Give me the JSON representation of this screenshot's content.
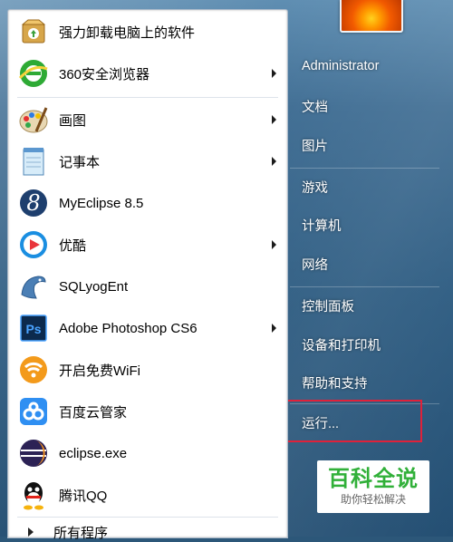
{
  "programs": [
    {
      "label": "强力卸载电脑上的软件",
      "icon": "uninstall-box-icon",
      "submenu": false
    },
    {
      "label": "360安全浏览器",
      "icon": "360-browser-icon",
      "submenu": true
    },
    {
      "label": "画图",
      "icon": "paint-palette-icon",
      "submenu": true
    },
    {
      "label": "记事本",
      "icon": "notepad-icon",
      "submenu": true
    },
    {
      "label": "MyEclipse 8.5",
      "icon": "myeclipse-icon",
      "submenu": false
    },
    {
      "label": "优酷",
      "icon": "youku-icon",
      "submenu": true
    },
    {
      "label": "SQLyogEnt",
      "icon": "sqlyog-dolphin-icon",
      "submenu": false
    },
    {
      "label": "Adobe Photoshop CS6",
      "icon": "photoshop-icon",
      "submenu": true
    },
    {
      "label": "开启免费WiFi",
      "icon": "wifi-icon",
      "submenu": false
    },
    {
      "label": "百度云管家",
      "icon": "baidu-cloud-icon",
      "submenu": false
    },
    {
      "label": "eclipse.exe",
      "icon": "eclipse-icon",
      "submenu": false
    },
    {
      "label": "腾讯QQ",
      "icon": "qq-penguin-icon",
      "submenu": false
    }
  ],
  "all_programs": "所有程序",
  "right_links": {
    "user": "Administrator",
    "documents": "文档",
    "pictures": "图片",
    "games": "游戏",
    "computer": "计算机",
    "network": "网络",
    "control_panel": "控制面板",
    "devices": "设备和打印机",
    "help": "帮助和支持",
    "run": "运行..."
  },
  "watermark": {
    "title": "百科全说",
    "subtitle": "助你轻松解决"
  },
  "colors": {
    "highlight_border": "#e0213a",
    "watermark_green": "#31b039"
  }
}
